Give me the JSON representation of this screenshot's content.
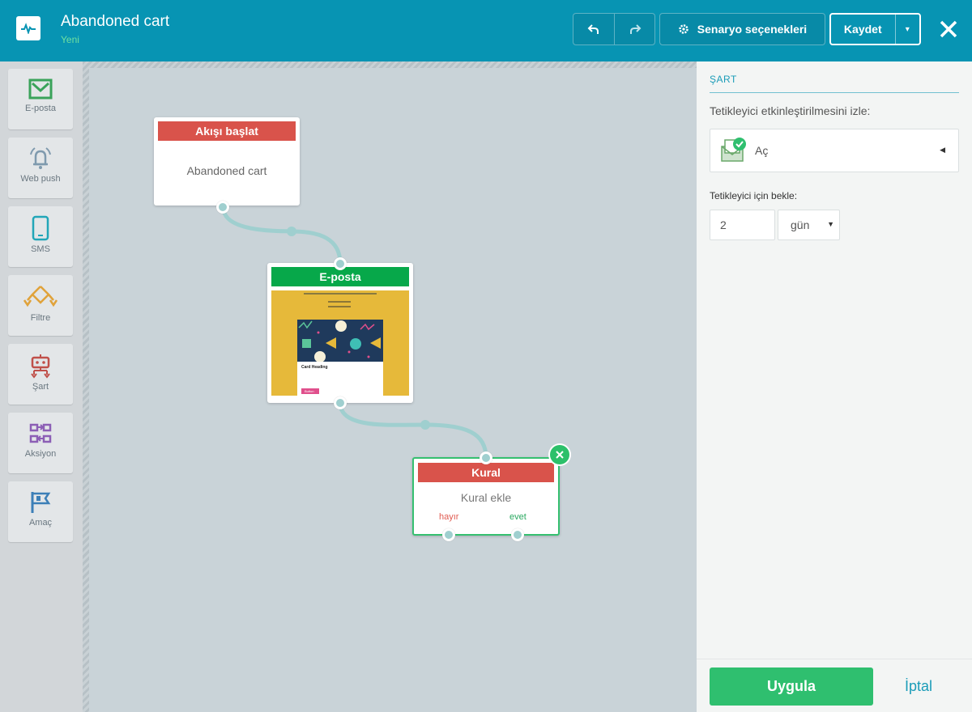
{
  "header": {
    "title": "Abandoned cart",
    "status": "Yeni",
    "scenario_options_label": "Senaryo seçenekleri",
    "save_label": "Kaydet"
  },
  "toolbox": {
    "items": [
      {
        "label": "E-posta",
        "icon": "envelope-icon",
        "color": "#3aa35a"
      },
      {
        "label": "Web push",
        "icon": "bell-icon",
        "color": "#7f9aae"
      },
      {
        "label": "SMS",
        "icon": "phone-icon",
        "color": "#22a6b8"
      },
      {
        "label": "Filtre",
        "icon": "filter-branch-icon",
        "color": "#e0a23a"
      },
      {
        "label": "Şart",
        "icon": "condition-robot-icon",
        "color": "#c0504a"
      },
      {
        "label": "Aksiyon",
        "icon": "action-icon",
        "color": "#8c5fb5"
      },
      {
        "label": "Amaç",
        "icon": "flag-icon",
        "color": "#3c7fb7"
      }
    ]
  },
  "canvas": {
    "start_node": {
      "header": "Akışı başlat",
      "body": "Abandoned cart",
      "color": "#d9534b"
    },
    "email_node": {
      "header": "E-posta",
      "color": "#07a84a",
      "preview_heading": "Card Heading",
      "preview_button": "Button"
    },
    "rule_node": {
      "header": "Kural",
      "body": "Kural ekle",
      "no_label": "hayır",
      "yes_label": "evet",
      "color": "#d9534b"
    }
  },
  "panel": {
    "title": "ŞART",
    "watch_label": "Tetikleyici etkinleştirilmesini izle:",
    "watch_value": "Aç",
    "wait_label": "Tetikleyici için bekle:",
    "wait_value": "2",
    "wait_unit": "gün",
    "apply_label": "Uygula",
    "cancel_label": "İptal"
  },
  "colors": {
    "header_bg": "#0794b3",
    "accent_green": "#2fbf6f",
    "accent_blue": "#1a9cb8"
  }
}
